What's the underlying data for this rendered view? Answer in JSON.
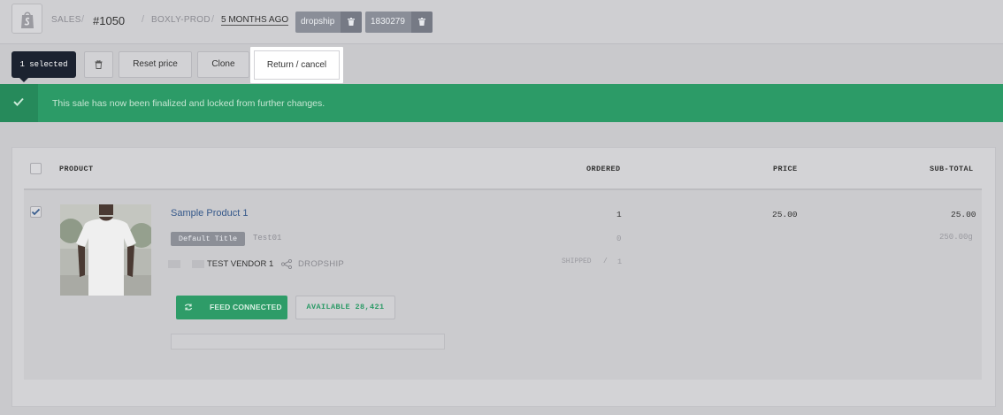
{
  "header": {
    "section": "SALES",
    "order_number": "#1050",
    "store": "BOXLY-PROD",
    "time_ago": "5 MONTHS AGO",
    "tags": [
      {
        "label": "dropship"
      },
      {
        "label": "1830279"
      }
    ],
    "logo_icon": "shopify-bag-icon"
  },
  "toolbar": {
    "selected_label": "1 selected",
    "delete_icon": "trash-icon",
    "reset_price_label": "Reset price",
    "clone_label": "Clone",
    "return_cancel_label": "Return / cancel"
  },
  "banner": {
    "message": "This sale has now been finalized and locked from further changes.",
    "color": "#2c9b67"
  },
  "table": {
    "columns": {
      "product": "PRODUCT",
      "ordered": "ORDERED",
      "price": "PRICE",
      "subtotal": "SUB-TOTAL"
    },
    "rows": [
      {
        "checked": true,
        "product_name": "Sample Product 1",
        "variant": "Default Title",
        "sku": "Test01",
        "vendor": "TEST VENDOR 1",
        "fulfillment": "DROPSHIP",
        "ordered": "1",
        "price": "25.00",
        "subtotal": "25.00",
        "ordered_secondary": "0",
        "weight": "250.00g",
        "shipped_label": "SHIPPED",
        "shipped_count": "1",
        "feed_label": "FEED CONNECTED",
        "available_label": "AVAILABLE 28,421"
      }
    ]
  }
}
